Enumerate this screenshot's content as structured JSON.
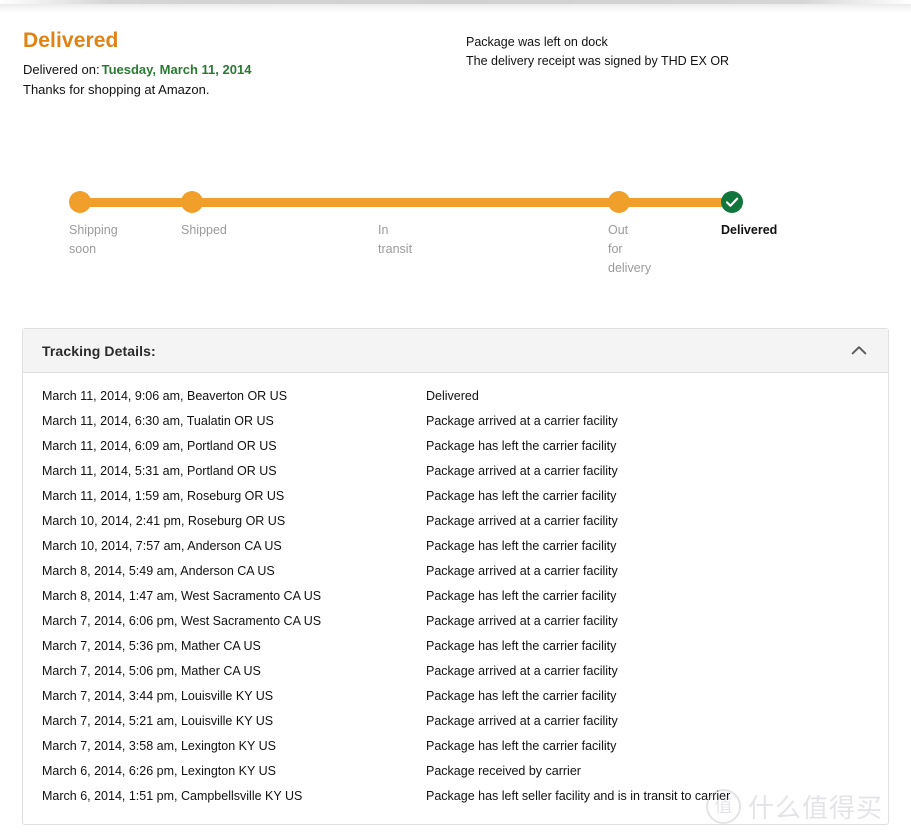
{
  "status": {
    "title": "Delivered",
    "delivered_on_label": "Delivered on:",
    "delivered_on_date": "Tuesday, March 11, 2014",
    "thanks": "Thanks for shopping at Amazon.",
    "title_color": "#e08214",
    "date_color": "#2a7a33"
  },
  "notes": [
    "Package was left on dock",
    "The delivery receipt was signed by THD EX OR"
  ],
  "tracker": {
    "bar_color": "#ef9f2a",
    "dot_color": "#f0a02a",
    "done_color": "#11763c",
    "steps": [
      {
        "label": "Shipping\nsoon",
        "state": "complete"
      },
      {
        "label": "Shipped",
        "state": "complete"
      },
      {
        "label": "In\ntransit",
        "state": "nodot"
      },
      {
        "label": "Out\nfor\ndelivery",
        "state": "complete"
      },
      {
        "label": "Delivered",
        "state": "current"
      }
    ]
  },
  "panel": {
    "title": "Tracking Details:",
    "collapse_icon": "chevron-up-icon",
    "columns": [
      "date_location",
      "status"
    ],
    "rows": [
      {
        "date_location": "March 11, 2014, 9:06 am, Beaverton OR US",
        "status": "Delivered"
      },
      {
        "date_location": "March 11, 2014, 6:30 am, Tualatin OR US",
        "status": "Package arrived at a carrier facility"
      },
      {
        "date_location": "March 11, 2014, 6:09 am, Portland OR US",
        "status": "Package has left the carrier facility"
      },
      {
        "date_location": "March 11, 2014, 5:31 am, Portland OR US",
        "status": "Package arrived at a carrier facility"
      },
      {
        "date_location": "March 11, 2014, 1:59 am, Roseburg OR US",
        "status": "Package has left the carrier facility"
      },
      {
        "date_location": "March 10, 2014, 2:41 pm, Roseburg OR US",
        "status": "Package arrived at a carrier facility"
      },
      {
        "date_location": "March 10, 2014, 7:57 am, Anderson CA US",
        "status": "Package has left the carrier facility"
      },
      {
        "date_location": "March 8, 2014, 5:49 am, Anderson CA US",
        "status": "Package arrived at a carrier facility"
      },
      {
        "date_location": "March 8, 2014, 1:47 am, West Sacramento CA US",
        "status": "Package has left the carrier facility"
      },
      {
        "date_location": "March 7, 2014, 6:06 pm, West Sacramento CA US",
        "status": "Package arrived at a carrier facility"
      },
      {
        "date_location": "March 7, 2014, 5:36 pm, Mather CA US",
        "status": "Package has left the carrier facility"
      },
      {
        "date_location": "March 7, 2014, 5:06 pm, Mather CA US",
        "status": "Package arrived at a carrier facility"
      },
      {
        "date_location": "March 7, 2014, 3:44 pm, Louisville KY US",
        "status": "Package has left the carrier facility"
      },
      {
        "date_location": "March 7, 2014, 5:21 am, Louisville KY US",
        "status": "Package arrived at a carrier facility"
      },
      {
        "date_location": "March 7, 2014, 3:58 am, Lexington KY US",
        "status": "Package has left the carrier facility"
      },
      {
        "date_location": "March 6, 2014, 6:26 pm, Lexington KY US",
        "status": "Package received by carrier"
      },
      {
        "date_location": "March 6, 2014, 1:51 pm, Campbellsville KY US",
        "status": "Package has left seller facility and is in transit to carrier"
      }
    ]
  },
  "watermark": {
    "mark": "值",
    "text": "什么值得买"
  }
}
